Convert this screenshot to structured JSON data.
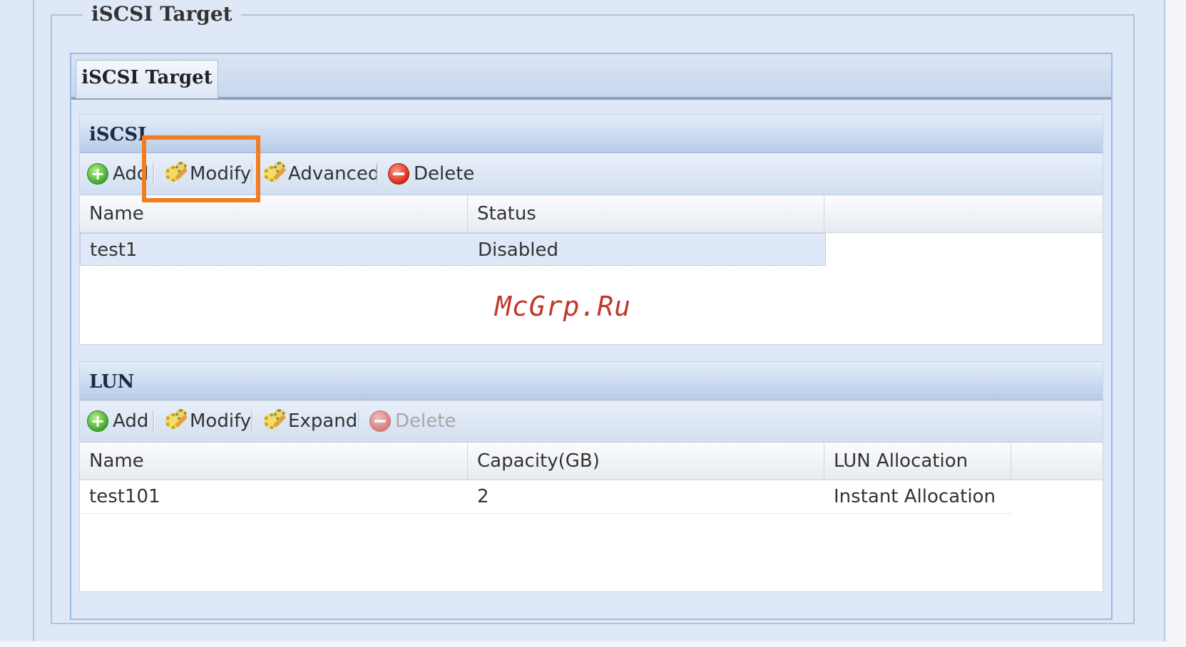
{
  "fieldset": {
    "legend": "iSCSI Target"
  },
  "tabs": [
    {
      "label": "iSCSI Target"
    }
  ],
  "iscsi_panel": {
    "title": "iSCSI",
    "toolbar": {
      "add": "Add",
      "modify": "Modify",
      "advanced": "Advanced",
      "delete": "Delete"
    },
    "columns": [
      "Name",
      "Status"
    ],
    "rows": [
      {
        "name": "test1",
        "status": "Disabled"
      }
    ]
  },
  "lun_panel": {
    "title": "LUN",
    "toolbar": {
      "add": "Add",
      "modify": "Modify",
      "expand": "Expand",
      "delete": "Delete"
    },
    "columns": [
      "Name",
      "Capacity(GB)",
      "LUN Allocation"
    ],
    "rows": [
      {
        "name": "test101",
        "capacity": "2",
        "allocation": "Instant Allocation"
      }
    ]
  },
  "watermark": "McGrp.Ru",
  "colors": {
    "highlight": "#f47c20",
    "watermark": "#c0392b",
    "panel_header": "#c9d9ef"
  }
}
